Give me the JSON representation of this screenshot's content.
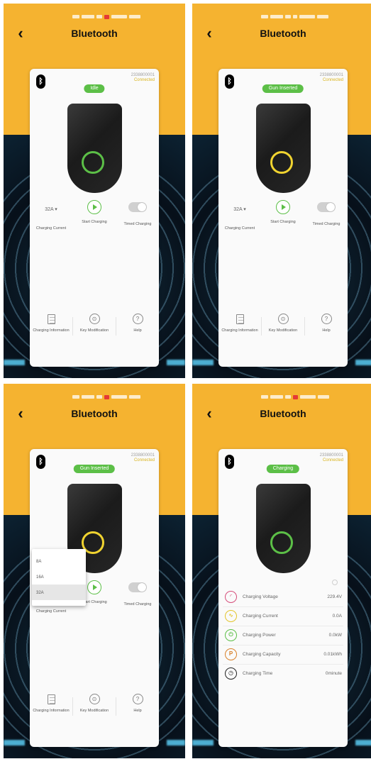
{
  "screens": [
    {
      "title": "Bluetooth",
      "serial_number": "2338800001",
      "connection_status": "Connected",
      "status_pill": "Idle",
      "status_color": "#5cbf47",
      "ring_color": "#5cbf47",
      "controls": {
        "current_value": "32A ▾",
        "current_label": "Charging Current",
        "start_label": "Start Charging",
        "timed_label": "Timed Charging"
      },
      "nav": {
        "info_label": "Charging Information",
        "key_label": "Key Modification",
        "help_label": "Help"
      }
    },
    {
      "title": "Bluetooth",
      "serial_number": "2338800001",
      "connection_status": "Connected",
      "status_pill": "Gun Inserted",
      "status_color": "#5cbf47",
      "ring_color": "#f0d330",
      "controls": {
        "current_value": "32A ▾",
        "current_label": "Charging Current",
        "start_label": "Start Charging",
        "timed_label": "Timed Charging"
      },
      "nav": {
        "info_label": "Charging Information",
        "key_label": "Key Modification",
        "help_label": "Help"
      }
    },
    {
      "title": "Bluetooth",
      "serial_number": "2338800001",
      "connection_status": "Connected",
      "status_pill": "Gun Inserted",
      "status_color": "#5cbf47",
      "ring_color": "#f0d330",
      "dropdown_options": [
        "8A",
        "16A",
        "32A"
      ],
      "dropdown_selected": "32A",
      "controls": {
        "current_label": "Charging Current",
        "start_label": "Start Charging",
        "timed_label": "Timed Charging"
      },
      "nav": {
        "info_label": "Charging Information",
        "key_label": "Key Modification",
        "help_label": "Help"
      }
    },
    {
      "title": "Bluetooth",
      "serial_number": "2338800001",
      "connection_status": "Connected",
      "status_pill": "Charging",
      "status_color": "#5cbf47",
      "ring_color": "#5cbf47",
      "readings": [
        {
          "label": "Charging Voltage",
          "value": "229.4V",
          "icon": "voltage-gauge-icon",
          "color": "#d64d7a"
        },
        {
          "label": "Charging Current",
          "value": "0.0A",
          "icon": "current-wave-icon",
          "color": "#e3c52c"
        },
        {
          "label": "Charging Power",
          "value": "0.0kW",
          "icon": "power-plug-icon",
          "color": "#5cbf47"
        },
        {
          "label": "Charging Capacity",
          "value": "0.01kWh",
          "icon": "parking-p-icon",
          "color": "#d9812a"
        },
        {
          "label": "Charging Time",
          "value": "0minute",
          "icon": "clock-icon",
          "color": "#222222"
        }
      ]
    }
  ]
}
